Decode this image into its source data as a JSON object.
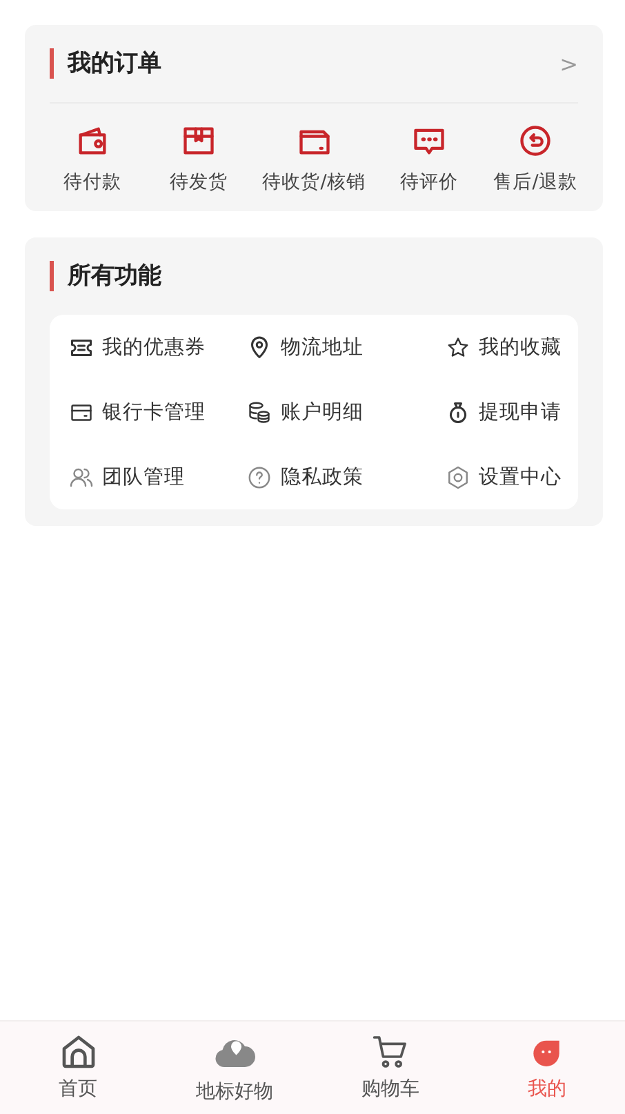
{
  "orders": {
    "title": "我的订单",
    "chevron": ">",
    "items": [
      {
        "label": "待付款"
      },
      {
        "label": "待发货"
      },
      {
        "label": "待收货/核销"
      },
      {
        "label": "待评价"
      },
      {
        "label": "售后/退款"
      }
    ]
  },
  "functions": {
    "title": "所有功能",
    "items": [
      {
        "label": "我的优惠券"
      },
      {
        "label": "物流地址"
      },
      {
        "label": "我的收藏"
      },
      {
        "label": "银行卡管理"
      },
      {
        "label": "账户明细"
      },
      {
        "label": "提现申请"
      },
      {
        "label": "团队管理"
      },
      {
        "label": "隐私政策"
      },
      {
        "label": "设置中心"
      }
    ]
  },
  "tab_bar": [
    {
      "label": "首页",
      "selected": false
    },
    {
      "label": "地标好物",
      "selected": false
    },
    {
      "label": "购物车",
      "selected": false
    },
    {
      "label": "我的",
      "selected": true
    }
  ]
}
